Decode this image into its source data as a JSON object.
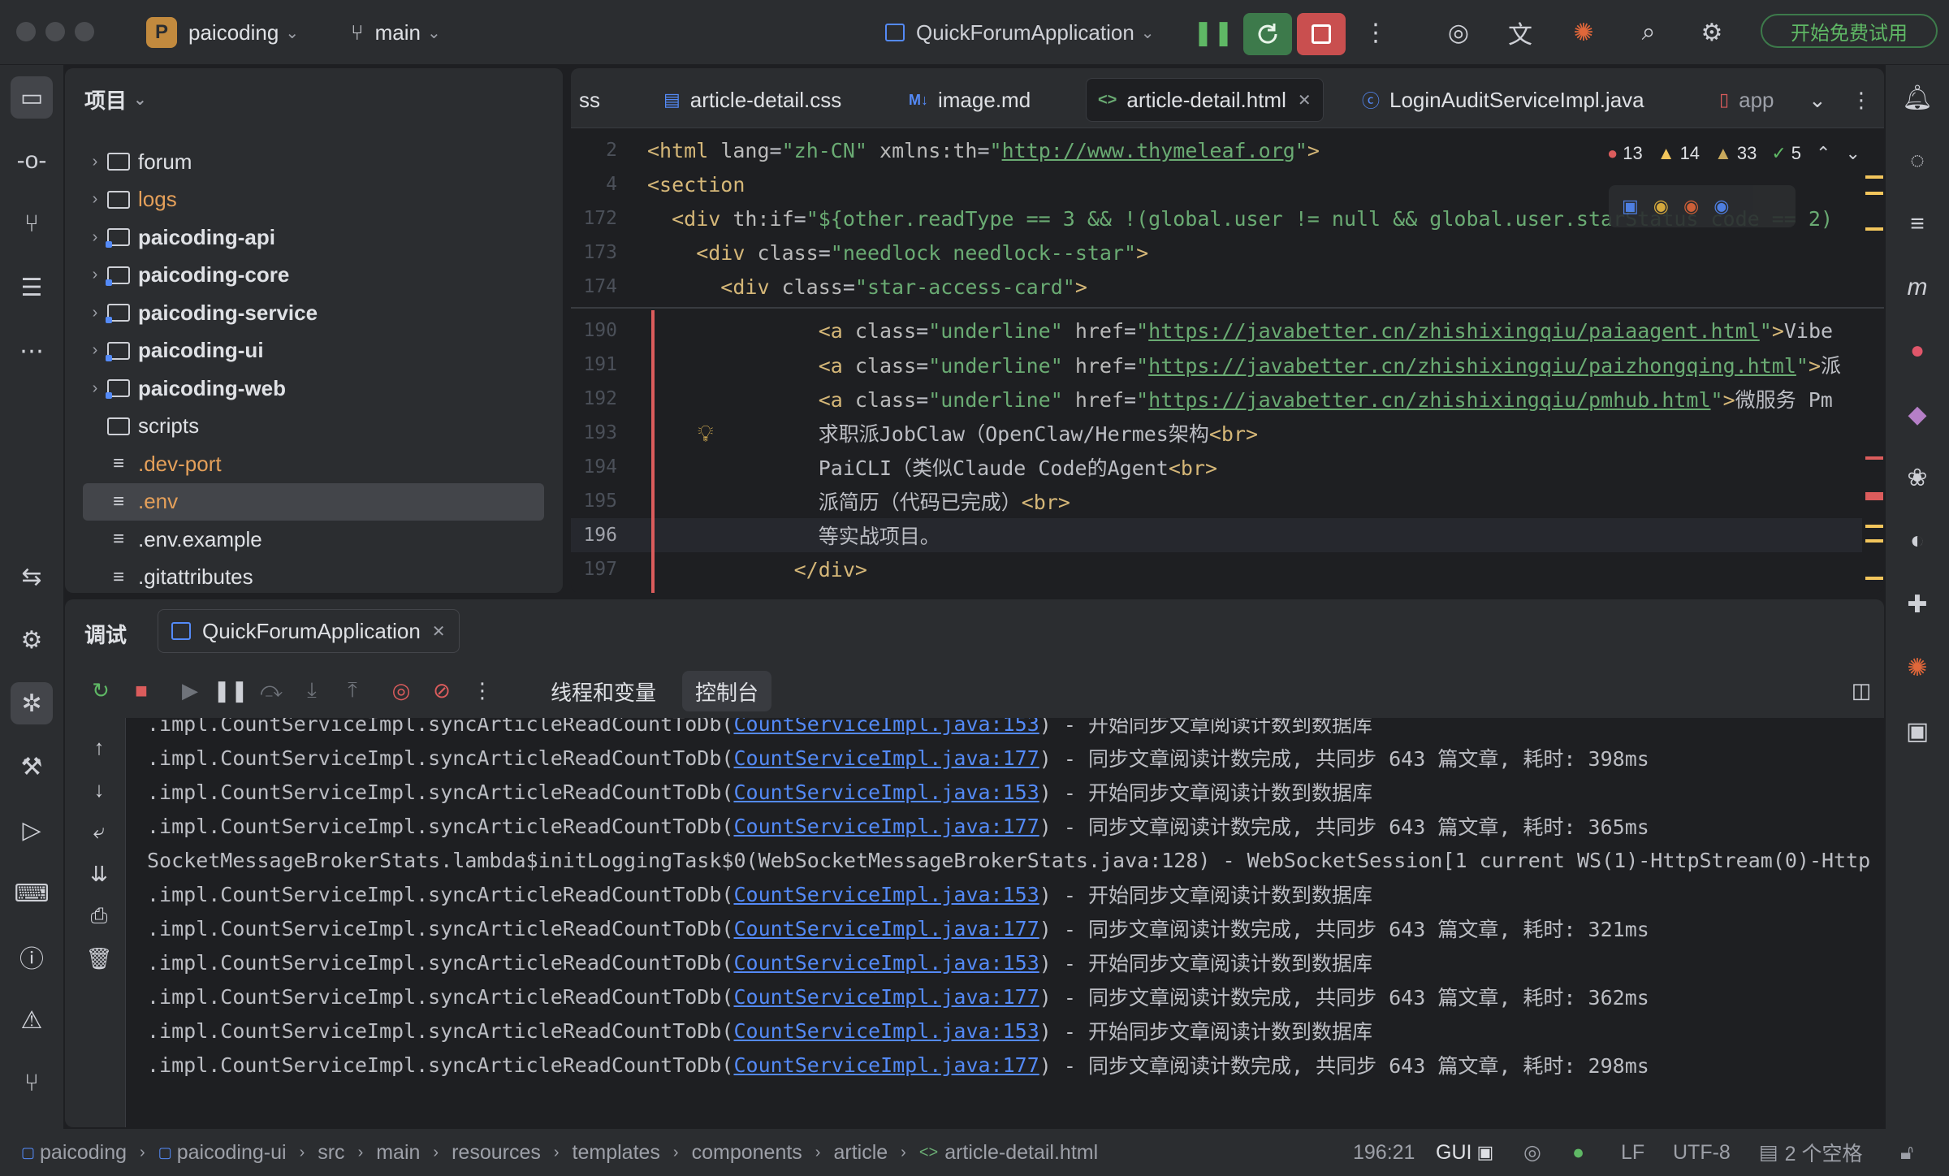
{
  "titlebar": {
    "project_initial": "P",
    "project_name": "paicoding",
    "branch": "main",
    "run_config": "QuickForumApplication",
    "trial_button": "开始免费试用"
  },
  "project_panel": {
    "title": "项目",
    "items": [
      {
        "label": "forum",
        "kind": "folder",
        "expandable": true,
        "color": "#dfe1e5"
      },
      {
        "label": "logs",
        "kind": "folder",
        "expandable": true,
        "color": "#e5a05a"
      },
      {
        "label": "paicoding-api",
        "kind": "module",
        "expandable": true,
        "color": "#dfe1e5"
      },
      {
        "label": "paicoding-core",
        "kind": "module",
        "expandable": true,
        "color": "#dfe1e5"
      },
      {
        "label": "paicoding-service",
        "kind": "module",
        "expandable": true,
        "color": "#dfe1e5"
      },
      {
        "label": "paicoding-ui",
        "kind": "module",
        "expandable": true,
        "color": "#dfe1e5"
      },
      {
        "label": "paicoding-web",
        "kind": "module",
        "expandable": true,
        "color": "#dfe1e5"
      },
      {
        "label": "scripts",
        "kind": "folder",
        "expandable": false,
        "color": "#dfe1e5"
      },
      {
        "label": ".dev-port",
        "kind": "file",
        "expandable": false,
        "color": "#e5a05a"
      },
      {
        "label": ".env",
        "kind": "file",
        "expandable": false,
        "color": "#e5a05a",
        "selected": true
      },
      {
        "label": ".env.example",
        "kind": "file",
        "expandable": false,
        "color": "#dfe1e5"
      },
      {
        "label": ".gitattributes",
        "kind": "file",
        "expandable": false,
        "color": "#dfe1e5"
      }
    ]
  },
  "editor": {
    "tabs": [
      {
        "label": "ss",
        "icon": ""
      },
      {
        "label": "article-detail.css",
        "icon": "css-file-icon"
      },
      {
        "label": "image.md",
        "icon": "markdown-file-icon"
      },
      {
        "label": "article-detail.html",
        "icon": "html-file-icon",
        "active": true
      },
      {
        "label": "LoginAuditServiceImpl.java",
        "icon": "java-class-icon"
      },
      {
        "label": "app",
        "icon": "app-file-icon"
      }
    ],
    "inspections": {
      "errors": "13",
      "warnings": "14",
      "weak_warnings": "33",
      "ok": "5"
    },
    "sticky_lines": [
      {
        "num": "2",
        "parts": [
          [
            "tg",
            "<html "
          ],
          [
            "at",
            "lang"
          ],
          [
            "tx",
            "="
          ],
          [
            "st",
            "\"zh-CN\" "
          ],
          [
            "at",
            "xmlns:th"
          ],
          [
            "tx",
            "="
          ],
          [
            "st",
            "\""
          ],
          [
            "ul",
            "http://www.thymeleaf.org"
          ],
          [
            "st",
            "\""
          ],
          [
            "tg",
            ">"
          ]
        ]
      },
      {
        "num": "4",
        "parts": [
          [
            "tg",
            "<section"
          ]
        ]
      },
      {
        "num": "172",
        "parts": [
          [
            "tg",
            "  <div "
          ],
          [
            "at",
            "th:if"
          ],
          [
            "tx",
            "="
          ],
          [
            "st",
            "\"${other.readType == 3 && !(global.user != null && global.user.starStatus code == 2)"
          ]
        ]
      },
      {
        "num": "173",
        "parts": [
          [
            "tg",
            "    <div "
          ],
          [
            "at",
            "class"
          ],
          [
            "tx",
            "="
          ],
          [
            "st",
            "\"needlock needlock--star\""
          ],
          [
            "tg",
            ">"
          ]
        ]
      },
      {
        "num": "174",
        "parts": [
          [
            "tg",
            "      <div "
          ],
          [
            "at",
            "class"
          ],
          [
            "tx",
            "="
          ],
          [
            "st",
            "\"star-access-card\""
          ],
          [
            "tg",
            ">"
          ]
        ]
      }
    ],
    "lines": [
      {
        "num": "190",
        "parts": [
          [
            "tg",
            "              <a "
          ],
          [
            "at",
            "class"
          ],
          [
            "tx",
            "="
          ],
          [
            "st",
            "\"underline\" "
          ],
          [
            "at",
            "href"
          ],
          [
            "tx",
            "="
          ],
          [
            "st",
            "\""
          ],
          [
            "ul",
            "https://javabetter.cn/zhishixingqiu/paiaagent.html"
          ],
          [
            "st",
            "\""
          ],
          [
            "tg",
            ">"
          ],
          [
            "tx",
            "Vibe"
          ]
        ]
      },
      {
        "num": "191",
        "parts": [
          [
            "tg",
            "              <a "
          ],
          [
            "at",
            "class"
          ],
          [
            "tx",
            "="
          ],
          [
            "st",
            "\"underline\" "
          ],
          [
            "at",
            "href"
          ],
          [
            "tx",
            "="
          ],
          [
            "st",
            "\""
          ],
          [
            "ul",
            "https://javabetter.cn/zhishixingqiu/paizhongqing.html"
          ],
          [
            "st",
            "\""
          ],
          [
            "tg",
            ">"
          ],
          [
            "tx",
            "派"
          ]
        ]
      },
      {
        "num": "192",
        "parts": [
          [
            "tg",
            "              <a "
          ],
          [
            "at",
            "class"
          ],
          [
            "tx",
            "="
          ],
          [
            "st",
            "\"underline\" "
          ],
          [
            "at",
            "href"
          ],
          [
            "tx",
            "="
          ],
          [
            "st",
            "\""
          ],
          [
            "ul",
            "https://javabetter.cn/zhishixingqiu/pmhub.html"
          ],
          [
            "st",
            "\""
          ],
          [
            "tg",
            ">"
          ],
          [
            "tx",
            "微服务 Pm"
          ]
        ]
      },
      {
        "num": "193",
        "parts": [
          [
            "tx",
            "              求职派JobClaw（OpenClaw/Hermes架构"
          ],
          [
            "tg",
            "<br>"
          ]
        ]
      },
      {
        "num": "194",
        "parts": [
          [
            "tx",
            "              PaiCLI（类似Claude Code的Agent"
          ],
          [
            "tg",
            "<br>"
          ]
        ]
      },
      {
        "num": "195",
        "parts": [
          [
            "tx",
            "              派简历（代码已完成）"
          ],
          [
            "tg",
            "<br>"
          ]
        ]
      },
      {
        "num": "196",
        "parts": [
          [
            "tx",
            "              等实战项目。"
          ]
        ],
        "current": true
      },
      {
        "num": "197",
        "parts": [
          [
            "tg",
            "            </div>"
          ]
        ]
      }
    ]
  },
  "debug": {
    "title": "调试",
    "session_tab": "QuickForumApplication",
    "subtabs": [
      "线程和变量",
      "控制台"
    ],
    "active_subtab": "控制台",
    "console_lines": [
      {
        "pre": ".impl.CountServiceImpl.syncArticleReadCountToDb(",
        "link": "CountServiceImpl.java:153",
        "post": ") - 开始同步文章阅读计数到数据库"
      },
      {
        "pre": ".impl.CountServiceImpl.syncArticleReadCountToDb(",
        "link": "CountServiceImpl.java:177",
        "post": ") - 同步文章阅读计数完成, 共同步 643 篇文章, 耗时: 398ms"
      },
      {
        "pre": ".impl.CountServiceImpl.syncArticleReadCountToDb(",
        "link": "CountServiceImpl.java:153",
        "post": ") - 开始同步文章阅读计数到数据库"
      },
      {
        "pre": ".impl.CountServiceImpl.syncArticleReadCountToDb(",
        "link": "CountServiceImpl.java:177",
        "post": ") - 同步文章阅读计数完成, 共同步 643 篇文章, 耗时: 365ms"
      },
      {
        "pre": "SocketMessageBrokerStats.lambda$initLoggingTask$0(WebSocketMessageBrokerStats.java:128) - WebSocketSession[1 current WS(1)-HttpStream(0)-Http",
        "link": "",
        "post": ""
      },
      {
        "pre": ".impl.CountServiceImpl.syncArticleReadCountToDb(",
        "link": "CountServiceImpl.java:153",
        "post": ") - 开始同步文章阅读计数到数据库"
      },
      {
        "pre": ".impl.CountServiceImpl.syncArticleReadCountToDb(",
        "link": "CountServiceImpl.java:177",
        "post": ") - 同步文章阅读计数完成, 共同步 643 篇文章, 耗时: 321ms"
      },
      {
        "pre": ".impl.CountServiceImpl.syncArticleReadCountToDb(",
        "link": "CountServiceImpl.java:153",
        "post": ") - 开始同步文章阅读计数到数据库"
      },
      {
        "pre": ".impl.CountServiceImpl.syncArticleReadCountToDb(",
        "link": "CountServiceImpl.java:177",
        "post": ") - 同步文章阅读计数完成, 共同步 643 篇文章, 耗时: 362ms"
      },
      {
        "pre": ".impl.CountServiceImpl.syncArticleReadCountToDb(",
        "link": "CountServiceImpl.java:153",
        "post": ") - 开始同步文章阅读计数到数据库"
      },
      {
        "pre": ".impl.CountServiceImpl.syncArticleReadCountToDb(",
        "link": "CountServiceImpl.java:177",
        "post": ") - 同步文章阅读计数完成, 共同步 643 篇文章, 耗时: 298ms"
      }
    ]
  },
  "statusbar": {
    "breadcrumbs": [
      "paicoding",
      "paicoding-ui",
      "src",
      "main",
      "resources",
      "templates",
      "components",
      "article",
      "article-detail.html"
    ],
    "position": "196:21",
    "gui": "GUI",
    "line_separator": "LF",
    "encoding": "UTF-8",
    "indent": "2 个空格"
  },
  "colors": {
    "syntax_tag": "#d5b778",
    "syntax_attr": "#bababa",
    "syntax_string": "#6aab73",
    "link": "#548af7",
    "error": "#db5c5c",
    "warning": "#f2c55c",
    "ok": "#5fb865"
  }
}
